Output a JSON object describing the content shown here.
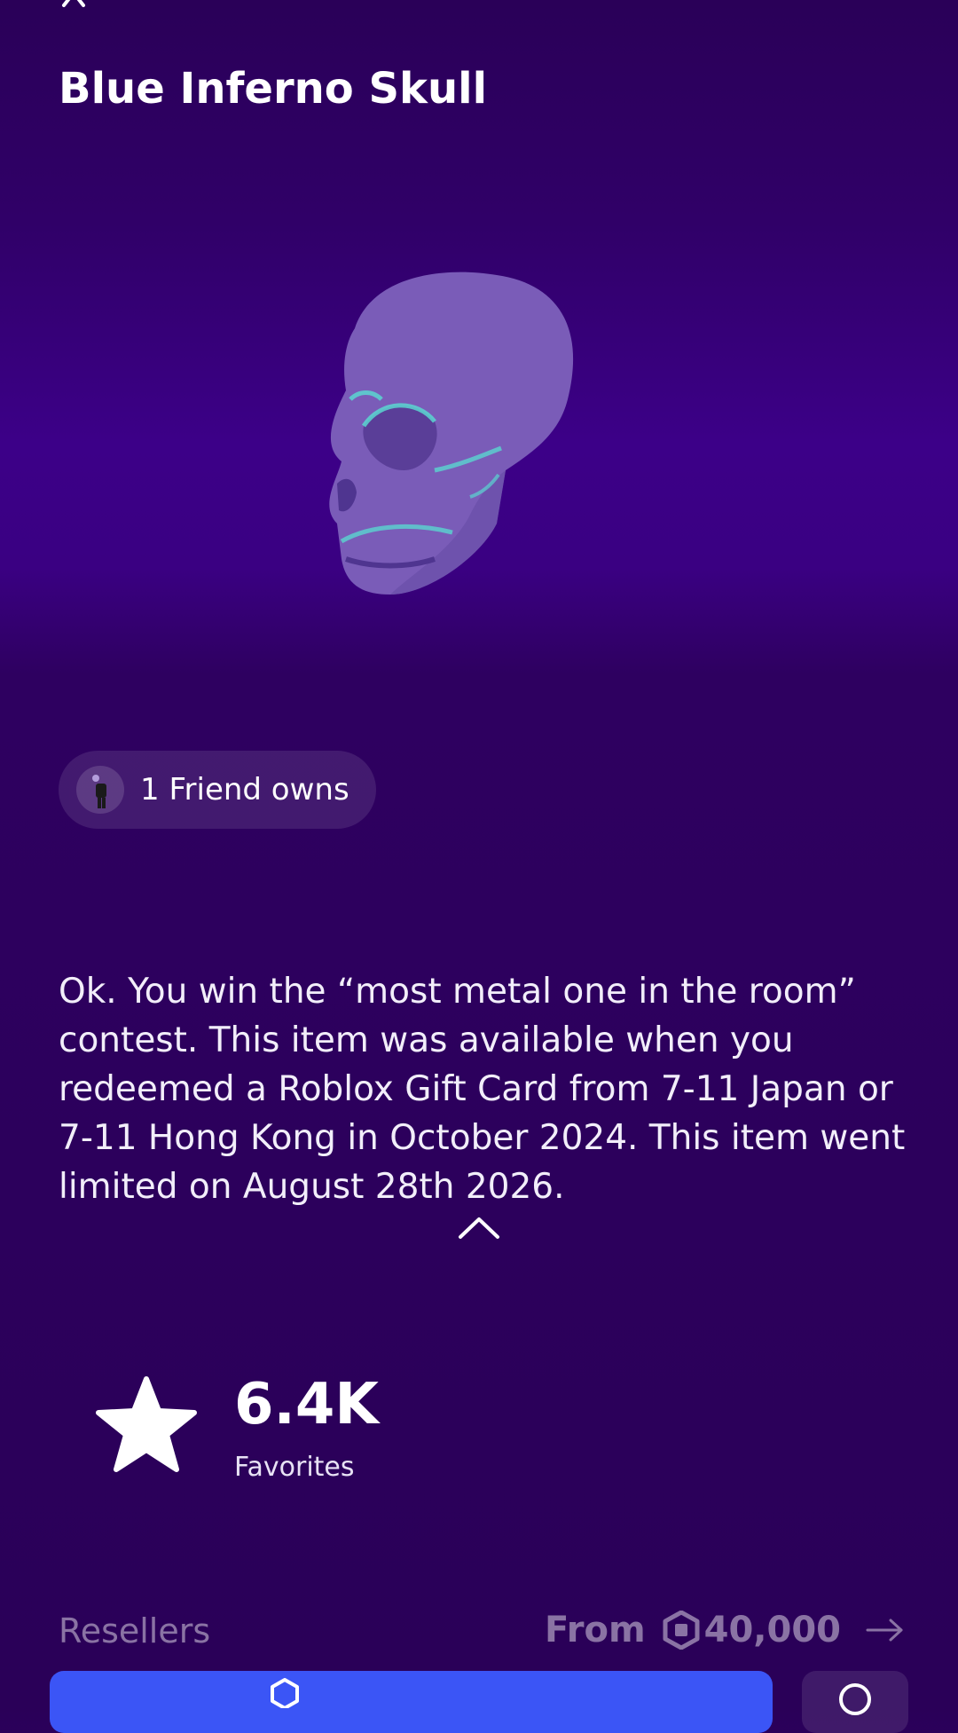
{
  "item": {
    "title": "Blue Inferno Skull",
    "description": "Ok. You win the “most metal one in the room” contest. This item was available when you redeemed a Roblox Gift Card from 7-11 Japan or 7-11 Hong Kong in October 2024. This item went limited on August 28th 2026."
  },
  "friends": {
    "label": "1 Friend owns"
  },
  "favorites": {
    "count": "6.4K",
    "label": "Favorites"
  },
  "resellers": {
    "label": "Resellers",
    "price_prefix": "From",
    "price": "40,000"
  },
  "icons": {
    "close": "close-icon",
    "collapse": "chevron-up-icon",
    "favorite": "star-icon",
    "currency": "robux-icon",
    "navigate": "arrow-right-icon"
  },
  "colors": {
    "background": "#2a0058",
    "primary_button": "#3b55f6",
    "skull": "#7a5cb8",
    "skull_accent": "#5ad6d0"
  }
}
